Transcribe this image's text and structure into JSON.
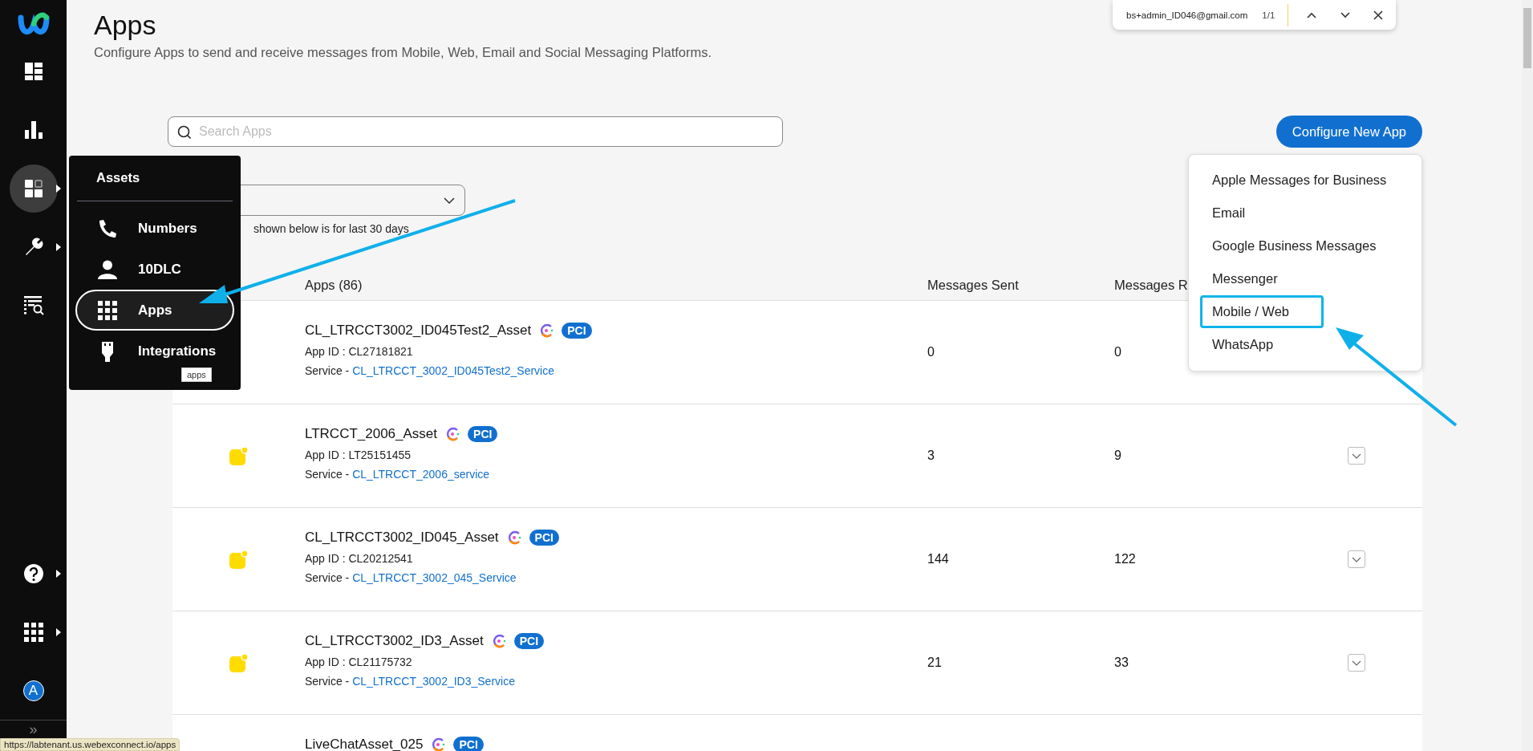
{
  "sidebar": {
    "items": [
      {
        "kind": "dashboard",
        "selected": false,
        "submenu": false
      },
      {
        "kind": "analytics",
        "selected": false,
        "submenu": false
      },
      {
        "kind": "assets",
        "selected": true,
        "submenu": true
      },
      {
        "kind": "tools",
        "selected": false,
        "submenu": true
      },
      {
        "kind": "logs",
        "selected": false,
        "submenu": false
      }
    ],
    "bottom_items": [
      {
        "kind": "help",
        "submenu": true
      },
      {
        "kind": "grid",
        "submenu": true
      },
      {
        "kind": "avatar",
        "initial": "A",
        "submenu": false
      }
    ],
    "collapse": "»"
  },
  "flyout": {
    "title": "Assets",
    "items": [
      {
        "kind": "phone",
        "label": "Numbers",
        "selected": false
      },
      {
        "kind": "person",
        "label": "10DLC",
        "selected": false
      },
      {
        "kind": "grid",
        "label": "Apps",
        "selected": true
      },
      {
        "kind": "plug",
        "label": "Integrations",
        "selected": false
      }
    ],
    "tooltip": "apps"
  },
  "header": {
    "title": "Apps",
    "subtitle": "Configure Apps to send and receive messages from Mobile, Web, Email and Social Messaging Platforms."
  },
  "search": {
    "placeholder": "Search Apps"
  },
  "configure_button": "Configure New App",
  "configure_menu": {
    "items": [
      {
        "label": "Apple Messages for Business",
        "annotated": false
      },
      {
        "label": "Email",
        "annotated": false
      },
      {
        "label": "Google Business Messages",
        "annotated": false
      },
      {
        "label": "Messenger",
        "annotated": false
      },
      {
        "label": "Mobile / Web",
        "annotated": true
      },
      {
        "label": "WhatsApp",
        "annotated": false
      }
    ]
  },
  "note": "shown below is for last 30 days",
  "table": {
    "columns": [
      "Apps (86)",
      "Messages Sent",
      "Messages R"
    ],
    "rows": [
      {
        "name": "CL_LTRCCT3002_ID045Test2_Asset",
        "badge": "PCI",
        "app_id": "App ID : CL27181821",
        "service_label": "Service - ",
        "service": "CL_LTRCCT_3002_ID045Test2_Service",
        "sent": "0",
        "received": "0",
        "expand_button": false
      },
      {
        "kind": "mobile_app",
        "name": "LTRCCT_2006_Asset",
        "badge": "PCI",
        "app_id": "App ID : LT25151455",
        "service_label": "Service - ",
        "service": "CL_LTRCCT_2006_service",
        "sent": "3",
        "received": "9",
        "expand_button": true
      },
      {
        "kind": "mobile_app",
        "name": "CL_LTRCCT3002_ID045_Asset",
        "badge": "PCI",
        "app_id": "App ID : CL20212541",
        "service_label": "Service - ",
        "service": "CL_LTRCCT_3002_045_Service",
        "sent": "144",
        "received": "122",
        "expand_button": true
      },
      {
        "kind": "mobile_app",
        "name": "CL_LTRCCT3002_ID3_Asset",
        "badge": "PCI",
        "app_id": "App ID : CL21175732",
        "service_label": "Service - ",
        "service": "CL_LTRCCT_3002_ID3_Service",
        "sent": "21",
        "received": "33",
        "expand_button": true
      },
      {
        "name": "LiveChatAsset_025",
        "badge": "PCI",
        "expand_button": false
      }
    ]
  },
  "find_bar": {
    "query": "bs+admin_ID046@gmail.com",
    "count": "1/1"
  },
  "status_url": "https://labtenant.us.webexconnect.io/apps"
}
